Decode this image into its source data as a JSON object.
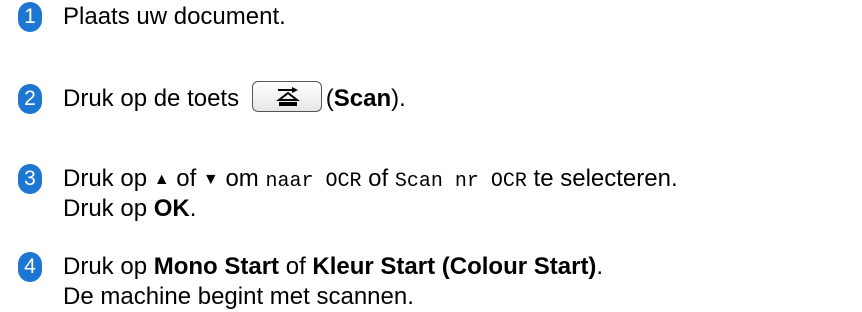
{
  "colors": {
    "badge": "#1d77d2"
  },
  "steps": [
    {
      "number": "1",
      "text": "Plaats uw document."
    },
    {
      "number": "2",
      "pre": "Druk op de toets",
      "key_icon": "scan-icon",
      "paren_open": "(",
      "bold": "Scan",
      "paren_close": ")."
    },
    {
      "number": "3",
      "p1": "Druk op",
      "up_arrow": "▲",
      "p2": "of",
      "down_arrow": "▼",
      "p3": "om",
      "m1": "naar OCR",
      "p4": "of",
      "m2": "Scan nr OCR",
      "p5": "te selecteren.",
      "l2_pre": "Druk op",
      "l2_bold": "OK",
      "l2_post": "."
    },
    {
      "number": "4",
      "p1": "Druk op",
      "b1": "Mono Start",
      "p2": "of",
      "b2": "Kleur Start (Colour Start)",
      "p3": ".",
      "l2": "De machine begint met scannen."
    }
  ]
}
